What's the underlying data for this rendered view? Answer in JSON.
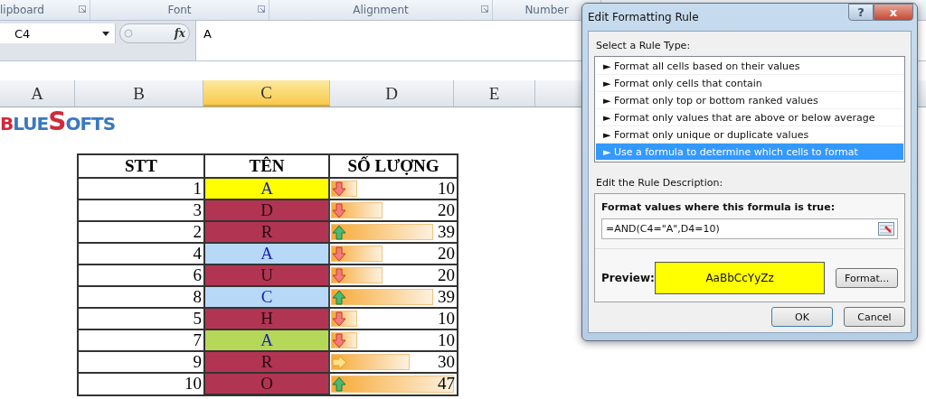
{
  "ribbon": {
    "groups": [
      {
        "label": "lipboard",
        "launcher": true
      },
      {
        "label": "Font",
        "launcher": true
      },
      {
        "label": "Alignment",
        "launcher": true
      },
      {
        "label": "Number",
        "launcher": false
      }
    ]
  },
  "formula_bar": {
    "name_box": "C4",
    "function_label": "fx",
    "value": "A"
  },
  "columns": [
    {
      "label": "A",
      "selected": false
    },
    {
      "label": "B",
      "selected": false
    },
    {
      "label": "C",
      "selected": true
    },
    {
      "label": "D",
      "selected": false
    },
    {
      "label": "E",
      "selected": false
    }
  ],
  "logo": "BLUESOFTS",
  "table": {
    "headers": [
      "STT",
      "TÊN",
      "SỐ LƯỢNG"
    ],
    "rows": [
      {
        "stt": "1",
        "name": "A",
        "color": "#ffff00",
        "kind": "down",
        "level": 0.21,
        "amount": "10"
      },
      {
        "stt": "3",
        "name": "D",
        "color": "#b23453",
        "kind": "down",
        "level": 0.42,
        "amount": "20"
      },
      {
        "stt": "2",
        "name": "R",
        "color": "#b23453",
        "kind": "up",
        "level": 0.83,
        "amount": "39"
      },
      {
        "stt": "4",
        "name": "A",
        "color": "#b8d8f8",
        "kind": "down",
        "level": 0.42,
        "amount": "20"
      },
      {
        "stt": "6",
        "name": "U",
        "color": "#b23453",
        "kind": "down",
        "level": 0.42,
        "amount": "20"
      },
      {
        "stt": "8",
        "name": "C",
        "color": "#b8d8f8",
        "kind": "up",
        "level": 0.83,
        "amount": "39"
      },
      {
        "stt": "5",
        "name": "H",
        "color": "#b23453",
        "kind": "down",
        "level": 0.21,
        "amount": "10"
      },
      {
        "stt": "7",
        "name": "A",
        "color": "#b6d858",
        "kind": "down",
        "level": 0.21,
        "amount": "10"
      },
      {
        "stt": "9",
        "name": "R",
        "color": "#b23453",
        "kind": "right",
        "level": 0.64,
        "amount": "30"
      },
      {
        "stt": "10",
        "name": "O",
        "color": "#b23453",
        "kind": "up",
        "level": 1,
        "amount": "47"
      }
    ]
  },
  "dialog": {
    "title": "Edit Formatting Rule",
    "help": "?",
    "close": "x",
    "select_label": "Select a Rule Type:",
    "rule_types": [
      {
        "label": "► Format all cells based on their values",
        "selected": false
      },
      {
        "label": "► Format only cells that contain",
        "selected": false
      },
      {
        "label": "► Format only top or bottom ranked values",
        "selected": false
      },
      {
        "label": "► Format only values that are above or below average",
        "selected": false
      },
      {
        "label": "► Format only unique or duplicate values",
        "selected": false
      },
      {
        "label": "► Use a formula to determine which cells to format",
        "selected": true
      }
    ],
    "description_label": "Edit the Rule Description:",
    "formula_label": "Format values where this formula is true:",
    "formula": "=AND(C4=\"A\",D4=10)",
    "preview": {
      "label": "Preview:",
      "text": "AaBbCcYyZz",
      "color": "#ffff00"
    },
    "format_button": "Format...",
    "ok": "OK",
    "cancel": "Cancel"
  }
}
